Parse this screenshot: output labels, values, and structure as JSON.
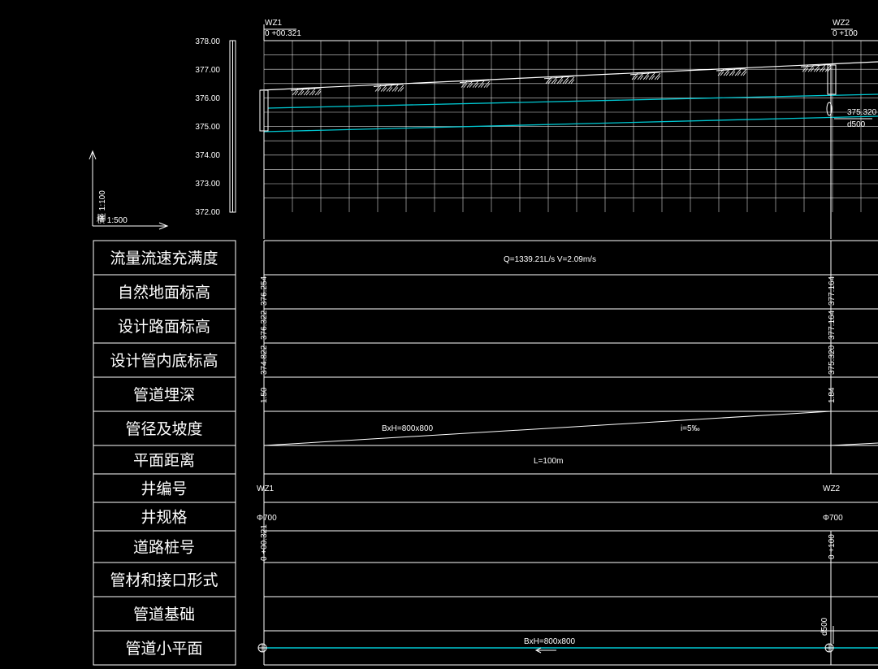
{
  "wells": [
    {
      "id": "WZ1",
      "station": "0 +00.321",
      "spec": "Φ700",
      "ground": "376.254",
      "road": "376.322",
      "invert": "374.822",
      "depth": "1.50"
    },
    {
      "id": "WZ2",
      "station": "0 +100",
      "spec": "Φ700",
      "ground": "377.164",
      "road": "377.164",
      "invert": "375.320",
      "depth": "1.84"
    }
  ],
  "elevation_ticks": [
    "378.00",
    "377.00",
    "376.00",
    "375.00",
    "374.00",
    "373.00",
    "372.00"
  ],
  "scale": {
    "vertical": "竖 1:100",
    "horizontal": "横 1:500"
  },
  "row_labels": [
    "流量流速充满度",
    "自然地面标高",
    "设计路面标高",
    "设计管内底标高",
    "管道埋深",
    "管径及坡度",
    "平面距离",
    "井编号",
    "井规格",
    "道路桩号",
    "管材和接口形式",
    "管道基础",
    "管道小平面"
  ],
  "flow_text": "Q=1339.21L/s V=2.09m/s",
  "pipe_size": "BxH=800x800",
  "slope": "i=5‰",
  "distance": "L=100m",
  "invert_callout": "375.320",
  "pipe_diameter": "d500",
  "plan_pipe_label": "BxH=800x800",
  "plan_label_wz2": "d500",
  "colors": {
    "background": "#000000",
    "lines": "#ffffff",
    "pipe": "#00c8d2"
  }
}
